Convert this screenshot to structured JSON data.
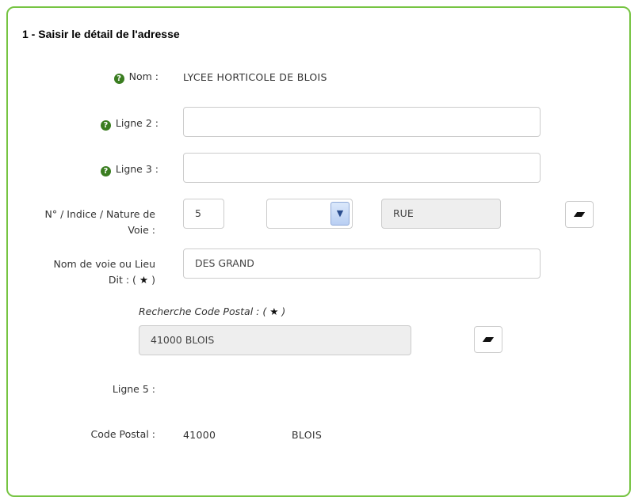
{
  "section": {
    "title": "1 - Saisir le détail de l'adresse"
  },
  "nom": {
    "label": "Nom :",
    "value": "LYCEE HORTICOLE DE BLOIS"
  },
  "ligne2": {
    "label": "Ligne 2 :",
    "value": ""
  },
  "ligne3": {
    "label": "Ligne 3 :",
    "value": ""
  },
  "voie": {
    "label_line1": "N° / Indice / Nature de",
    "label_line2": "Voie :",
    "numero": "5",
    "indice": "",
    "nature": "RUE"
  },
  "nom_voie": {
    "label_line1": "Nom de voie ou Lieu",
    "label_line2_prefix": "Dit : (",
    "label_line2_suffix": ")",
    "value": "DES GRAND"
  },
  "recherche_cp": {
    "label_prefix": "Recherche Code Postal : (",
    "label_suffix": ")",
    "value": "41000 BLOIS"
  },
  "ligne5": {
    "label": "Ligne 5 :",
    "value": ""
  },
  "code_postal": {
    "label": "Code Postal :",
    "cp": "41000",
    "ville": "BLOIS"
  },
  "icons": {
    "help": "help-circle-icon",
    "star": "star-icon",
    "eraser": "eraser-icon",
    "dropdown": "chevron-down-icon"
  },
  "colors": {
    "panel_border": "#76c442",
    "help_icon": "#3a7d20"
  }
}
